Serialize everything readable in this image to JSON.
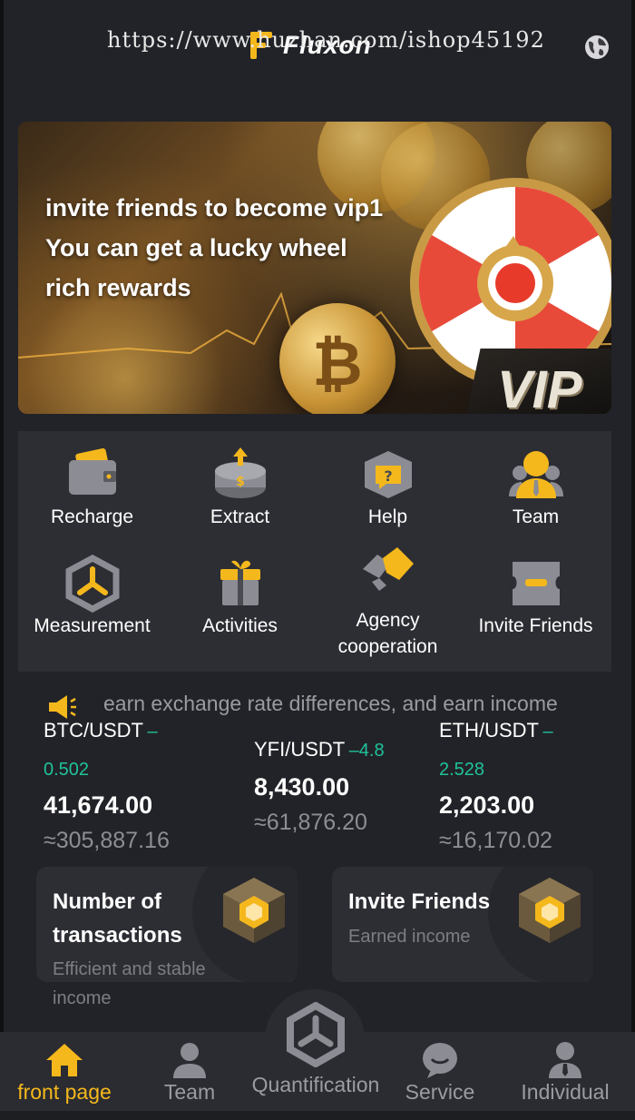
{
  "watermark": "https://www.huzhan.com/ishop45192",
  "brand": {
    "name": "Fluxon",
    "accent": "#f5b81c"
  },
  "header": {
    "globe_icon": "globe-icon"
  },
  "banner": {
    "lines": [
      "invite friends to become vip1",
      "You can get a lucky wheel",
      "rich rewards"
    ],
    "badge": "VIP",
    "slides": 2,
    "active_slide": 2
  },
  "menu": {
    "items": [
      {
        "label": "Recharge",
        "icon": "wallet-icon"
      },
      {
        "label": "Extract",
        "icon": "withdraw-icon"
      },
      {
        "label": "Help",
        "icon": "help-icon"
      },
      {
        "label": "Team",
        "icon": "team-icon"
      },
      {
        "label": "Measurement",
        "icon": "measurement-icon"
      },
      {
        "label": "Activities",
        "icon": "gift-icon"
      },
      {
        "label": "Agency cooperation",
        "icon": "handshake-icon"
      },
      {
        "label": "Invite Friends",
        "icon": "ticket-icon"
      }
    ]
  },
  "notice": {
    "icon": "megaphone-icon",
    "text": "earn exchange rate differences, and earn income"
  },
  "tickers": [
    {
      "pair": "BTC/USDT",
      "change_a": "–",
      "change_b": "0.502",
      "price": "41,674.00",
      "converted": "≈305,887.16"
    },
    {
      "pair": "YFI/USDT",
      "change_a": "–4.8",
      "change_b": "",
      "price": "8,430.00",
      "converted": "≈61,876.20"
    },
    {
      "pair": "ETH/USDT",
      "change_a": "–",
      "change_b": "2.528",
      "price": "2,203.00",
      "converted": "≈16,170.02"
    }
  ],
  "cards": [
    {
      "title_1": "Number of",
      "title_2": "transactions",
      "sub_1": "Efficient and stable",
      "sub_2": "income",
      "icon": "cube-icon"
    },
    {
      "title_1": "Invite Friends",
      "sub_1": "Earned income",
      "icon": "cube-icon"
    }
  ],
  "nav": {
    "items": [
      {
        "label": "front page",
        "icon": "home-icon",
        "active": true
      },
      {
        "label": "Team",
        "icon": "team-icon",
        "active": false
      },
      {
        "label": "Quantification",
        "icon": "quantification-icon",
        "active": false
      },
      {
        "label": "Service",
        "icon": "chat-icon",
        "active": false
      },
      {
        "label": "Individual",
        "icon": "user-icon",
        "active": false
      }
    ]
  },
  "colors": {
    "background": "#222328",
    "panel": "#2d2e34",
    "positive": "#1fc39b",
    "muted": "#8d8e93"
  }
}
